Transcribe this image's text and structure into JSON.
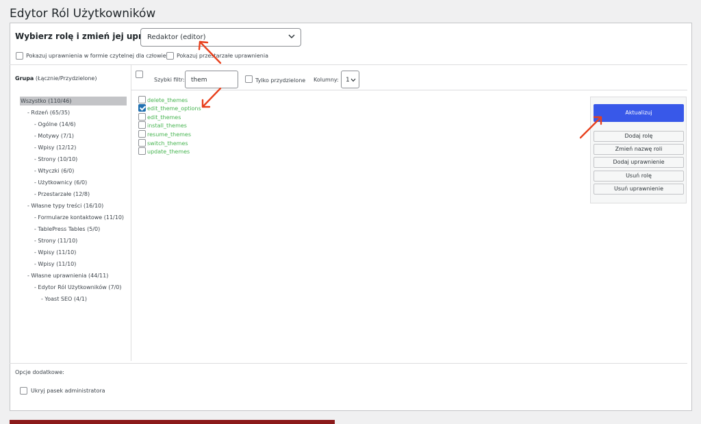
{
  "page": {
    "title": "Edytor Ról Użytkowników"
  },
  "role": {
    "label": "Wybierz rolę i zmień jej uprawnienia:",
    "selected": "Redaktor (editor)"
  },
  "options": {
    "human_readable": "Pokazuj uprawnienia w formie czytelnej dla człowieka",
    "deprecated": "Pokazuj przestarzałe uprawnienia"
  },
  "groups": {
    "header_bold": "Grupa",
    "header_rest": "(Łącznie/Przydzielone)",
    "items": [
      "Wszystko (110/46)",
      "- Rdzeń (65/35)",
      "- Ogólne (14/6)",
      "- Motywy (7/1)",
      "- Wpisy (12/12)",
      "- Strony (10/10)",
      "- Wtyczki (6/0)",
      "- Użytkownicy (6/0)",
      "- Przestarzałe (12/8)",
      "- Własne typy treści (16/10)",
      "- Formularze kontaktowe (11/10)",
      "- TablePress Tables (5/0)",
      "- Strony (11/10)",
      "- Wpisy (11/10)",
      "- Wpisy (11/10)",
      "- Własne uprawnienia (44/11)",
      "- Edytor Ról Użytkowników (7/0)",
      "- Yoast SEO (4/1)"
    ]
  },
  "filter": {
    "label": "Szybki filtr:",
    "value": "them",
    "assigned_only": "Tylko przydzielone",
    "columns_label": "Kolumny:",
    "columns_value": "1"
  },
  "capabilities": [
    {
      "name": "delete_themes",
      "checked": false
    },
    {
      "name": "edit_theme_options",
      "checked": true
    },
    {
      "name": "edit_themes",
      "checked": false
    },
    {
      "name": "install_themes",
      "checked": false
    },
    {
      "name": "resume_themes",
      "checked": false
    },
    {
      "name": "switch_themes",
      "checked": false
    },
    {
      "name": "update_themes",
      "checked": false
    }
  ],
  "actions": {
    "update": "Aktualizuj",
    "add_role": "Dodaj rolę",
    "rename_role": "Zmień nazwę roli",
    "add_capability": "Dodaj uprawnienie",
    "delete_role": "Usuń rolę",
    "delete_capability": "Usuń uprawnienie"
  },
  "extra": {
    "label": "Opcje dodatkowe:",
    "hide_admin_bar": "Ukryj pasek administratora"
  },
  "colors": {
    "primary_button": "#3858e9",
    "capability_text": "#46b450",
    "annotation_arrow": "#e8401c"
  }
}
